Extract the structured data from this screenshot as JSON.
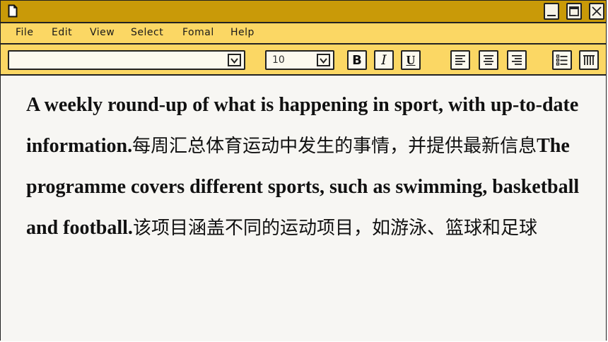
{
  "titlebar": {
    "app_icon": "document-icon",
    "buttons": [
      "minimize-icon",
      "maximize-icon",
      "close-icon"
    ]
  },
  "menu": {
    "items": [
      "File",
      "Edit",
      "View",
      "Select",
      "Fomal",
      "Help"
    ]
  },
  "toolbar": {
    "font_select_value": "",
    "size_select_value": "10",
    "bold_label": "B",
    "italic_label": "I",
    "underline_label": "U",
    "icons": [
      "align-left-icon",
      "align-center-icon",
      "align-right-icon",
      "bullet-list-icon",
      "columns-icon"
    ]
  },
  "content": {
    "segments": [
      {
        "text": "A weekly round-up of what is happening in sport, with up-to-date information.",
        "lang": "en"
      },
      {
        "text": "每周汇总体育运动中发生的事情，并提供最新信息",
        "lang": "zh"
      },
      {
        "text": "The programme covers different sports, such as swimming, basketball and football.",
        "lang": "en"
      },
      {
        "text": "该项目涵盖不同的运动项目，如游泳、篮球和足球",
        "lang": "zh"
      }
    ]
  },
  "colors": {
    "titlebar": "#c99a08",
    "menubar": "#fbd764",
    "document": "#f7f6f3",
    "border": "#222222"
  }
}
